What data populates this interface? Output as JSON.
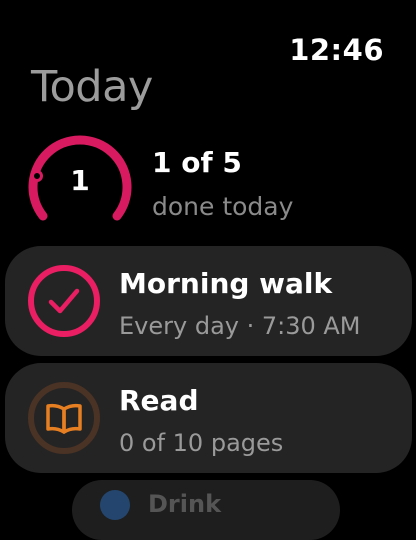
{
  "status": {
    "time": "12:46"
  },
  "header": {
    "title": "Today"
  },
  "summary": {
    "done_count": "1",
    "done_fraction": 0.2,
    "headline": "1 of 5",
    "caption": "done today",
    "ring_color": "#d81b60",
    "track_color": "#3a0e1c"
  },
  "habits": [
    {
      "title": "Morning walk",
      "subtitle": "Every day · 7:30 AM",
      "icon": "checkmark-icon",
      "state": "done",
      "accent": "#e91e63"
    },
    {
      "title": "Read",
      "subtitle": "0 of 10 pages",
      "icon": "book-icon",
      "state": "in-progress",
      "progress": 0,
      "accent": "#e67e22"
    },
    {
      "title": "Drink",
      "subtitle": "",
      "icon": "water-icon",
      "state": "partial-offscreen",
      "accent": "#24466e"
    }
  ]
}
